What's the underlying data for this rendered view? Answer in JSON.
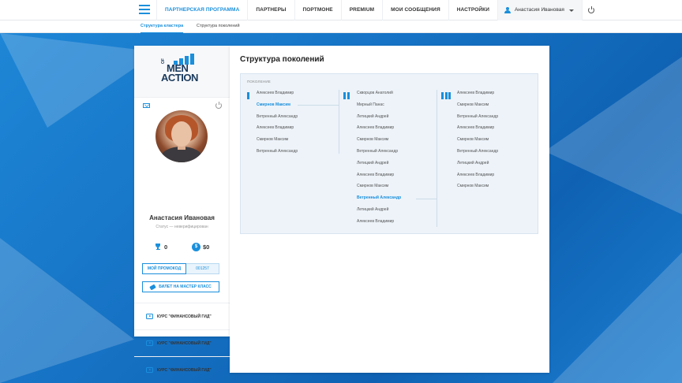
{
  "nav": {
    "items": [
      {
        "label": "ПАРТНЕРСКАЯ ПРОГРАММА",
        "active": true
      },
      {
        "label": "ПАРТНЕРЫ",
        "active": false
      },
      {
        "label": "ПОРТМОНЕ",
        "active": false
      },
      {
        "label": "PREMIUM",
        "active": false
      },
      {
        "label": "МОИ СООБЩЕНИЯ",
        "active": false
      },
      {
        "label": "НАСТРОЙКИ",
        "active": false
      }
    ],
    "user_name": "Анастасия Ивановая"
  },
  "subnav": {
    "tabs": [
      {
        "label": "Структура кластера",
        "active": true
      },
      {
        "label": "Структура поколений",
        "active": false
      }
    ]
  },
  "sidebar": {
    "logo": {
      "of": "OF",
      "men": "MEN",
      "action": "ACTION"
    },
    "user_name": "Анастасия Ивановая",
    "status": "Статус — неверифицирован",
    "trophies": "0",
    "balance": "$0",
    "coin_symbol": "$",
    "promo_label": "МОЙ ПРОМОКОД",
    "promo_code": "001257",
    "ticket_label": "БИЛЕТ НА МАСТЕР КЛАСС",
    "courses": [
      "КУРС \"ФИНАНСОВЫЙ ГИД\"",
      "КУРС \"ФИНАНСОВЫЙ ГИД\"",
      "КУРС \"ФИНАНСОВЫЙ ГИД\""
    ]
  },
  "main": {
    "title": "Структура поколений",
    "generation_label": "ПОКОЛЕНИЕ",
    "columns": [
      {
        "marker": "I",
        "items": [
          {
            "label": "Алексеев Владимир",
            "active": false
          },
          {
            "label": "Смирнов Максим",
            "active": true
          },
          {
            "label": "Ветренный Александр",
            "active": false
          },
          {
            "label": "Алексеев Владимир",
            "active": false
          },
          {
            "label": "Смирнов Максим",
            "active": false
          },
          {
            "label": "Ветренный Александр",
            "active": false
          }
        ]
      },
      {
        "marker": "II",
        "items": [
          {
            "label": "Скворцов Анатолий",
            "active": false
          },
          {
            "label": "Мирный Панас",
            "active": false
          },
          {
            "label": "Летицкий Андрей",
            "active": false
          },
          {
            "label": "Алексеев Владимир",
            "active": false
          },
          {
            "label": "Смирнов Максим",
            "active": false
          },
          {
            "label": "Ветренный Александр",
            "active": false
          },
          {
            "label": "Летицкий Андрей",
            "active": false
          },
          {
            "label": "Алексеев Владимир",
            "active": false
          },
          {
            "label": "Смирнов Максим",
            "active": false
          },
          {
            "label": "Ветренный Александр",
            "active": true
          },
          {
            "label": "Летицкий Андрей",
            "active": false
          },
          {
            "label": "Алексеев Владимир",
            "active": false
          }
        ]
      },
      {
        "marker": "III",
        "items": [
          {
            "label": "Алексеев Владимир",
            "active": false
          },
          {
            "label": "Смирнов Максим",
            "active": false
          },
          {
            "label": "Ветренный Александр",
            "active": false
          },
          {
            "label": "Алексеев Владимир",
            "active": false
          },
          {
            "label": "Смирнов Максим",
            "active": false
          },
          {
            "label": "Ветренный Александр",
            "active": false
          },
          {
            "label": "Летицкий Андрей",
            "active": false
          },
          {
            "label": "Алексеев Владимир",
            "active": false
          },
          {
            "label": "Смирнов Максим",
            "active": false
          }
        ]
      }
    ]
  },
  "colors": {
    "accent": "#1a8fdc",
    "background": "#1a78c8",
    "panel": "#ffffff",
    "generation_box": "#edf3f9"
  },
  "icons": {
    "menu": "hamburger-icon",
    "user": "user-icon",
    "power": "power-icon",
    "mail": "mail-icon",
    "trophy": "trophy-icon",
    "coin": "coin-icon",
    "ticket": "ticket-icon",
    "play": "play-icon"
  }
}
